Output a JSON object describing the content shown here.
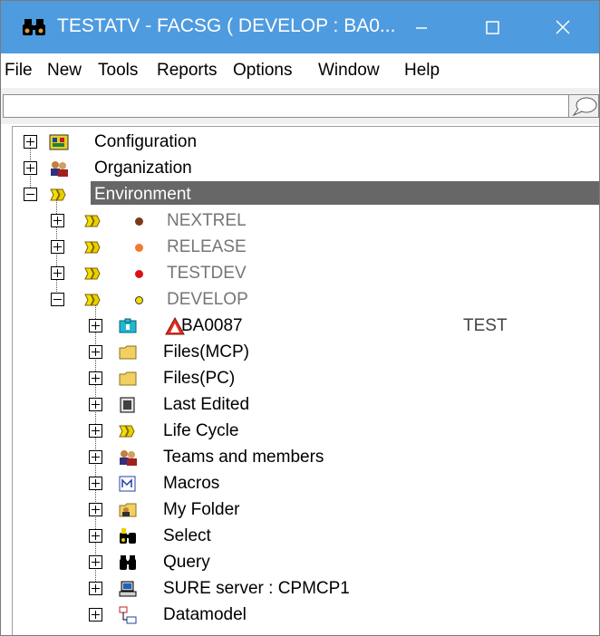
{
  "window": {
    "title": "TESTATV - FACSG ( DEVELOP : BA0...",
    "min_icon": "minimize-icon",
    "max_icon": "maximize-icon",
    "close_icon": "close-icon"
  },
  "menu": [
    "File",
    "New",
    "Tools",
    "Reports",
    "Options",
    "Window",
    "Help"
  ],
  "command": {
    "value": "",
    "chat_icon": "speech-bubble-icon"
  },
  "tree": {
    "root": [
      {
        "label": "Configuration",
        "icon": "configuration-icon",
        "expanded": false
      },
      {
        "label": "Organization",
        "icon": "organization-icon",
        "expanded": false
      },
      {
        "label": "Environment",
        "icon": "environment-icon",
        "expanded": true,
        "selected": true
      }
    ],
    "environments": [
      {
        "label": "NEXTREL",
        "status_color": "#7a3a1a",
        "expanded": false
      },
      {
        "label": "RELEASE",
        "status_color": "#f07a30",
        "expanded": false
      },
      {
        "label": "TESTDEV",
        "status_color": "#e01010",
        "expanded": false
      },
      {
        "label": "DEVELOP",
        "status_color": "#f4e000",
        "expanded": true
      }
    ],
    "develop_children": [
      {
        "label": "BA0087",
        "icon": "project-icon",
        "extra": "TEST",
        "warning_icon": "warning-icon"
      },
      {
        "label": "Files(MCP)",
        "icon": "folder-icon"
      },
      {
        "label": "Files(PC)",
        "icon": "folder-icon"
      },
      {
        "label": "Last Edited",
        "icon": "last-edited-icon"
      },
      {
        "label": "Life Cycle",
        "icon": "life-cycle-icon"
      },
      {
        "label": "Teams and members",
        "icon": "teams-icon"
      },
      {
        "label": "Macros",
        "icon": "macros-icon"
      },
      {
        "label": "My Folder",
        "icon": "my-folder-icon"
      },
      {
        "label": "Select",
        "icon": "select-binoculars-icon"
      },
      {
        "label": "Query",
        "icon": "query-binoculars-icon"
      },
      {
        "label": "SURE server : CPMCP1",
        "icon": "server-icon"
      },
      {
        "label": "Datamodel",
        "icon": "datamodel-icon"
      }
    ]
  }
}
